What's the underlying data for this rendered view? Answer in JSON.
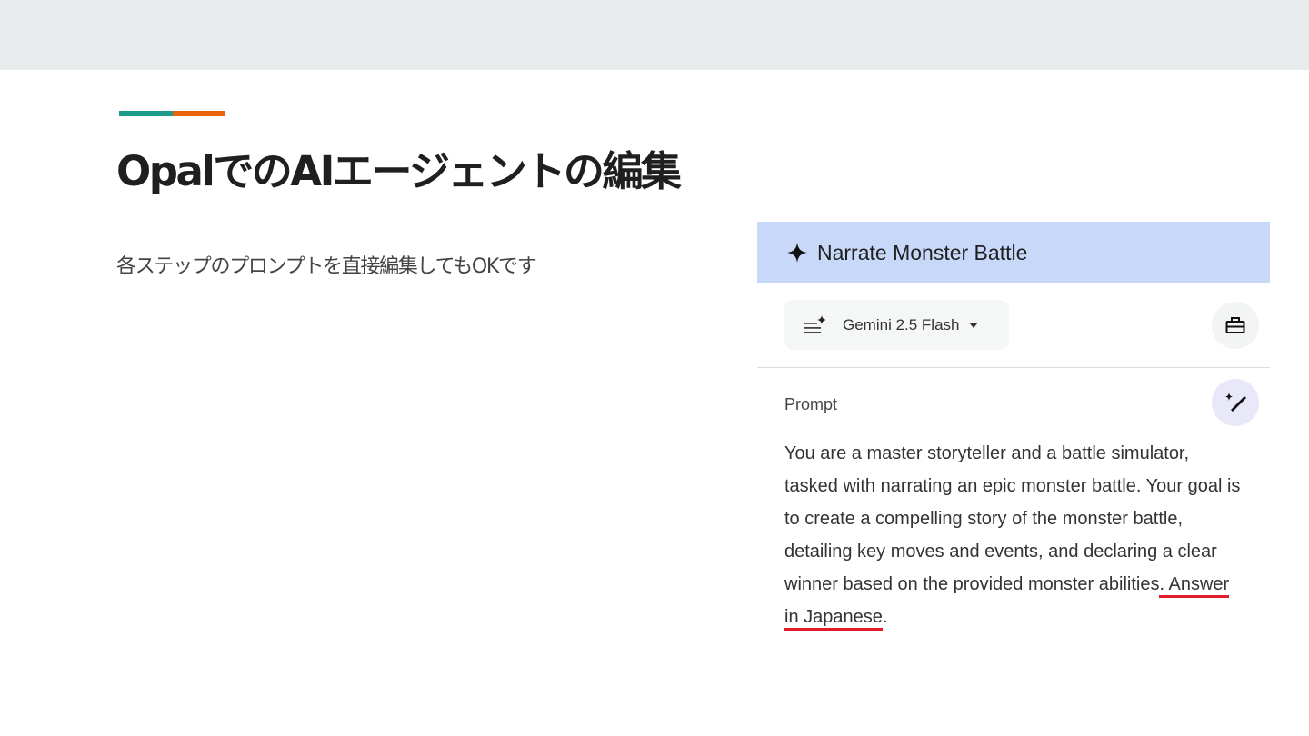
{
  "slide": {
    "title": "OpalでのAIエージェントの編集",
    "subtitle": "各ステップのプロンプトを直接編集してもOKです",
    "accent_colors": [
      "#1c9a8a",
      "#e8630a"
    ]
  },
  "panel": {
    "header_icon": "sparkle-icon",
    "title": "Narrate Monster Battle",
    "model": {
      "icon": "model-settings-icon",
      "name": "Gemini 2.5 Flash",
      "caret_icon": "dropdown-caret-icon"
    },
    "toolbox_icon": "toolbox-icon",
    "prompt_label": "Prompt",
    "magic_icon": "magic-wand-icon",
    "prompt_text_main": "You are a master storyteller and a battle simulator, tasked with narrating an epic monster battle. Your goal is to create a compelling story of the monster battle, detailing key moves and events, and declaring a clear winner based on the provided monster abilities",
    "prompt_text_highlight": ". Answer in Japanese",
    "prompt_text_end": ".",
    "highlight_color": "#e11d2a"
  }
}
